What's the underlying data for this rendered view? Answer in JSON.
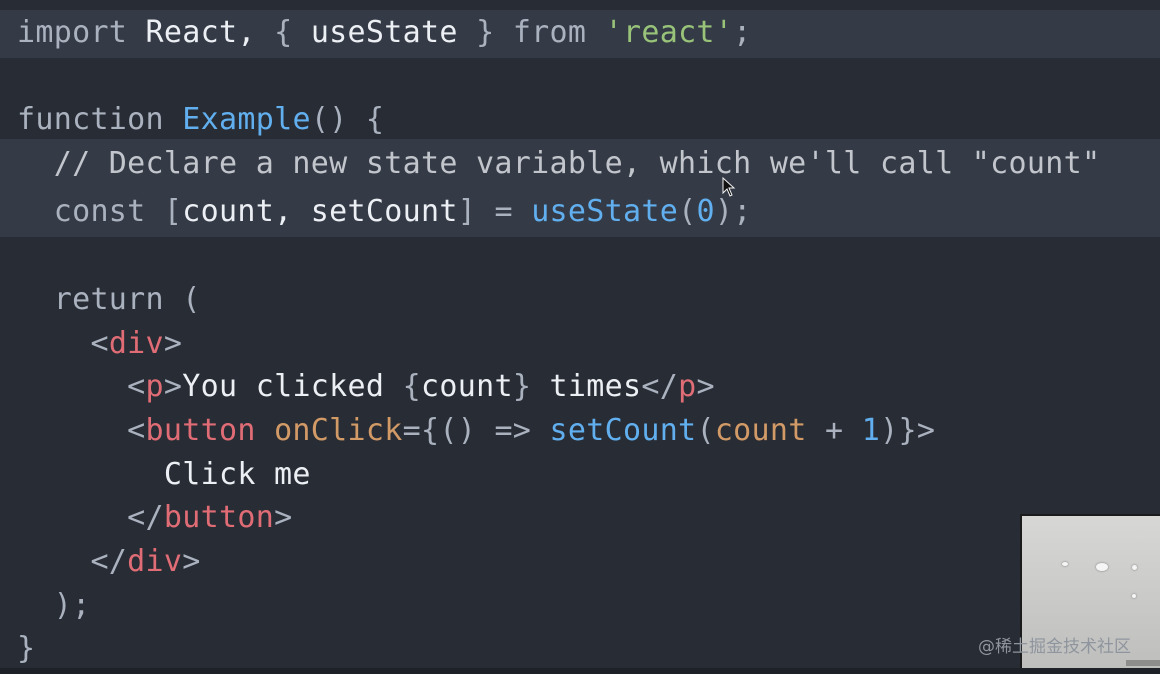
{
  "code": {
    "line1": {
      "t1": "import",
      "t2": " React, ",
      "t3": "{",
      "t4": " useState ",
      "t5": "}",
      "t6": " from ",
      "t7": "'react'",
      "t8": ";"
    },
    "line2": {
      "t1": "function",
      "t2": " ",
      "t3": "Example",
      "t4": "() {"
    },
    "line3": {
      "t1": "  // Declare a new state variable, which we'll call \"count\""
    },
    "line4": {
      "t1": "  const ",
      "t2": "[",
      "t3": "count, setCount",
      "t4": "]",
      "t5": " = ",
      "t6": "useState",
      "t7": "(",
      "t8": "0",
      "t9": ");"
    },
    "line5": {
      "t1": "  return",
      "t2": " ("
    },
    "line6": {
      "t1": "    <",
      "t2": "div",
      "t3": ">"
    },
    "line7": {
      "t1": "      <",
      "t2": "p",
      "t3": ">",
      "t4": "You clicked ",
      "t5": "{",
      "t6": "count",
      "t7": "}",
      "t8": " times",
      "t9": "</",
      "t10": "p",
      "t11": ">"
    },
    "line8": {
      "t1": "      <",
      "t2": "button",
      "t3": " onClick",
      "t4": "={",
      "t5": "()",
      "t6": " => ",
      "t7": "setCount",
      "t8": "(",
      "t9": "count",
      "t10": " + ",
      "t11": "1",
      "t12": ")}>"
    },
    "line9": {
      "t1": "        Click me"
    },
    "line10": {
      "t1": "      </",
      "t2": "button",
      "t3": ">"
    },
    "line11": {
      "t1": "    </",
      "t2": "div",
      "t3": ">"
    },
    "line12": {
      "t1": "  );"
    },
    "line13": {
      "t1": "}"
    }
  },
  "watermark": "@稀土掘金技术社区",
  "colors": {
    "background": "#282c34",
    "highlight_band": "#343b46",
    "keyword": "#abb2bf",
    "function": "#61afef",
    "string": "#98c379",
    "tag": "#e06c75"
  },
  "icons": {
    "cursor": "mouse-pointer-icon"
  }
}
